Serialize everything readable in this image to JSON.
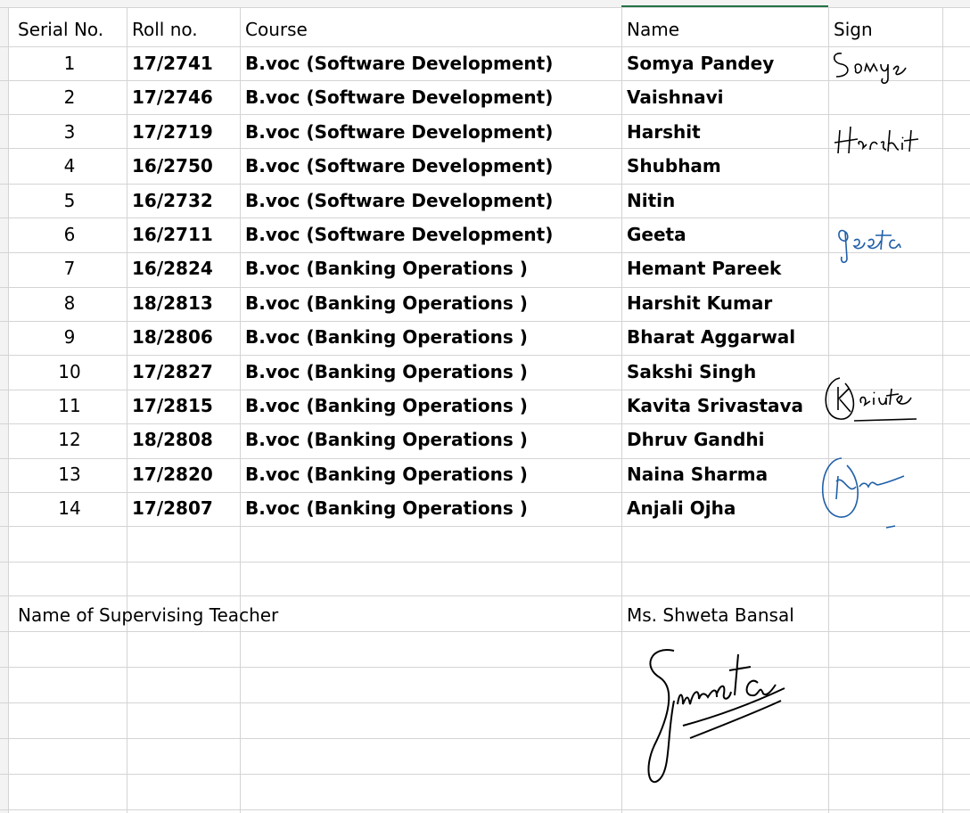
{
  "headers": {
    "serial": "Serial No.",
    "roll": "Roll no.",
    "course": "Course",
    "name": "Name",
    "sign": "Sign"
  },
  "rows": [
    {
      "serial": "1",
      "roll": "17/2741",
      "course": "B.voc  (Software Development)",
      "name": "Somya Pandey"
    },
    {
      "serial": "2",
      "roll": "17/2746",
      "course": "B.voc  (Software Development)",
      "name": "Vaishnavi"
    },
    {
      "serial": "3",
      "roll": "17/2719",
      "course": "B.voc  (Software Development)",
      "name": "Harshit"
    },
    {
      "serial": "4",
      "roll": "16/2750",
      "course": "B.voc  (Software Development)",
      "name": "Shubham"
    },
    {
      "serial": "5",
      "roll": "16/2732",
      "course": "B.voc  (Software Development)",
      "name": "Nitin"
    },
    {
      "serial": "6",
      "roll": "16/2711",
      "course": "B.voc  (Software Development)",
      "name": "Geeta"
    },
    {
      "serial": "7",
      "roll": "16/2824",
      "course": "B.voc (Banking Operations )",
      "name": "Hemant Pareek"
    },
    {
      "serial": "8",
      "roll": "18/2813",
      "course": "B.voc (Banking Operations )",
      "name": "Harshit Kumar"
    },
    {
      "serial": "9",
      "roll": "18/2806",
      "course": "B.voc (Banking Operations )",
      "name": "Bharat Aggarwal"
    },
    {
      "serial": "10",
      "roll": "17/2827",
      "course": "B.voc (Banking Operations )",
      "name": "Sakshi Singh"
    },
    {
      "serial": "11",
      "roll": "17/2815",
      "course": "B.voc (Banking Operations )",
      "name": "Kavita Srivastava"
    },
    {
      "serial": "12",
      "roll": "18/2808",
      "course": "B.voc (Banking Operations )",
      "name": "Dhruv Gandhi"
    },
    {
      "serial": "13",
      "roll": "17/2820",
      "course": "B.voc (Banking Operations )",
      "name": "Naina Sharma"
    },
    {
      "serial": "14",
      "roll": "17/2807",
      "course": "B.voc (Banking Operations )",
      "name": "Anjali Ojha"
    }
  ],
  "supervisor": {
    "label": "Name of Supervising Teacher",
    "name": "Ms. Shweta Bansal"
  },
  "signatures": {
    "somya": "Somya",
    "harshit": "Harshit",
    "geeta": "Geeta",
    "shweta": "Shweta"
  },
  "colors": {
    "gridline": "#d4d4d4",
    "active_column": "#217346",
    "ink_black": "#000000",
    "ink_blue": "#1f5fa8"
  }
}
